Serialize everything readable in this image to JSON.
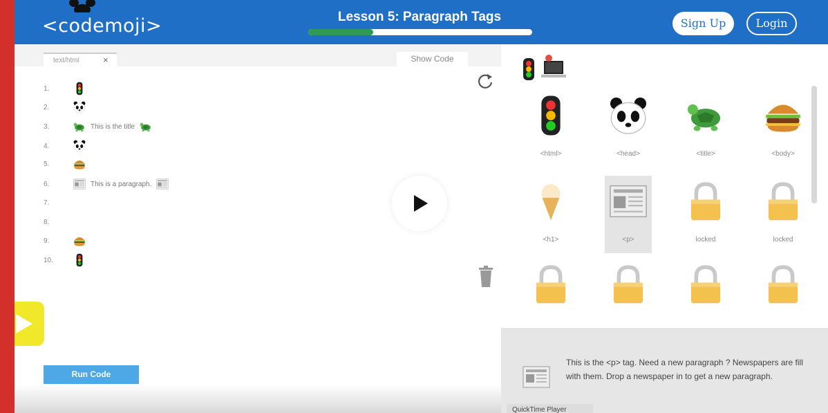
{
  "header": {
    "logo_text": "<codemoji>",
    "lesson_title": "Lesson 5: Paragraph Tags",
    "progress_fraction": 0.29,
    "signup_label": "Sign Up",
    "login_label": "Login"
  },
  "editor": {
    "tab_label": "text/html",
    "tab_close": "×",
    "show_code_label": "Show Code",
    "lines": [
      {
        "num": "1.",
        "icon": "traffic-light-icon",
        "text": ""
      },
      {
        "num": "2.",
        "icon": "panda-icon",
        "text": ""
      },
      {
        "num": "3.",
        "icon": "turtle-icon",
        "text": "This is the title"
      },
      {
        "num": "4.",
        "icon": "panda-icon",
        "text": ""
      },
      {
        "num": "5.",
        "icon": "burger-icon",
        "text": ""
      },
      {
        "num": "6.",
        "icon": "newspaper-icon",
        "text": "This is a paragraph."
      },
      {
        "num": "7.",
        "icon": "",
        "text": ""
      },
      {
        "num": "8.",
        "icon": "",
        "text": ""
      },
      {
        "num": "9.",
        "icon": "burger-icon",
        "text": ""
      },
      {
        "num": "10.",
        "icon": "traffic-light-icon",
        "text": ""
      }
    ],
    "run_code_label": "Run Code"
  },
  "palette": {
    "items": [
      {
        "icon": "traffic-light-icon",
        "label": "<html>"
      },
      {
        "icon": "panda-icon",
        "label": "<head>"
      },
      {
        "icon": "turtle-icon",
        "label": "<title>"
      },
      {
        "icon": "burger-icon",
        "label": "<body>"
      },
      {
        "icon": "ice-cream-icon",
        "label": "<h1>"
      },
      {
        "icon": "newspaper-icon",
        "label": "<p>"
      },
      {
        "icon": "lock-icon",
        "label": "locked"
      },
      {
        "icon": "lock-icon",
        "label": "locked"
      },
      {
        "icon": "lock-icon",
        "label": ""
      },
      {
        "icon": "lock-icon",
        "label": ""
      },
      {
        "icon": "lock-icon",
        "label": ""
      },
      {
        "icon": "lock-icon",
        "label": ""
      }
    ],
    "selected_label": "<p>"
  },
  "description": {
    "text": "This is the <p> tag. Need a new paragraph ? Newspapers are fill with them. Drop a newspaper in to get a new paragraph."
  },
  "overlay": {
    "quicktime_label": "QuickTime Player"
  },
  "colors": {
    "header_blue": "#1f6fc6",
    "progress_green": "#2e9a55",
    "run_button_blue": "#4ea8e6",
    "frame_red": "#d3302b"
  }
}
